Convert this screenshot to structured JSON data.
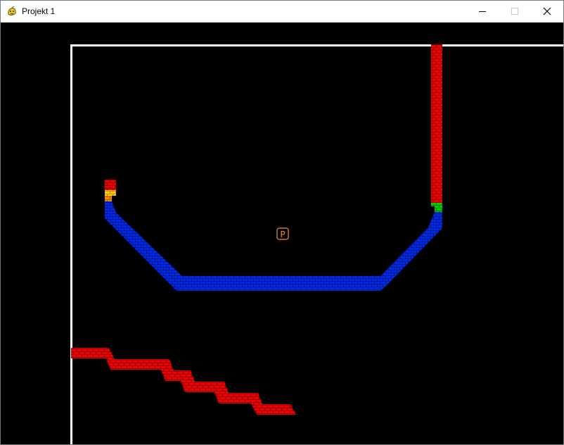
{
  "window": {
    "title": "Projekt 1",
    "icon": "pygame-snake-icon",
    "controls": [
      "minimize-icon",
      "maximize-icon",
      "close-icon"
    ]
  },
  "game": {
    "background_color": "#000000",
    "wall_color": "#ffffff",
    "pickup": {
      "label": "P",
      "color": "#ff8c28"
    },
    "brick_colors": {
      "red": "#ee0000",
      "blue": "#0028e6",
      "green": "#00d200",
      "yellow": "#ffcc00",
      "orange": "#ff8c00"
    }
  }
}
